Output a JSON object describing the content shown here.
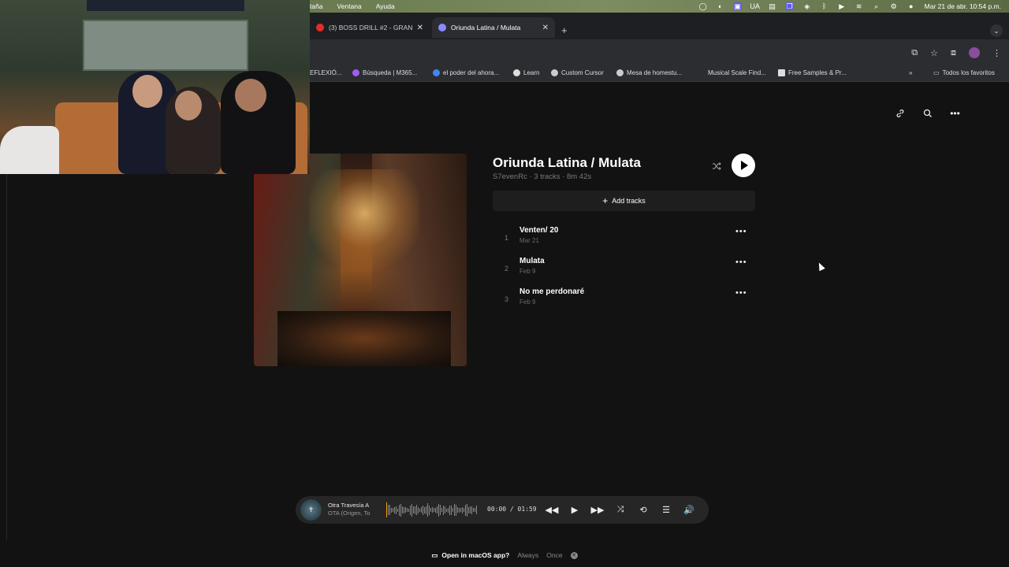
{
  "menubar": {
    "menus": [
      "taña",
      "Ventana",
      "Ayuda"
    ],
    "status_icons": [
      "record-icon",
      "activity-icon",
      "screen-icon",
      "ua-label",
      "keyboard-icon",
      "window-icon",
      "vpn-icon",
      "bluetooth-icon",
      "play-icon",
      "wifi-icon",
      "search-icon",
      "control-center-icon",
      "siri-icon"
    ],
    "ua_label": "UA",
    "datetime": "Mar 21 de abr.  10:54 p.m."
  },
  "tabs": [
    {
      "title": "(3) BOSS DRILL #2 - GRAND",
      "favicon_color": "#e52d27",
      "active": false
    },
    {
      "title": "Oriunda Latina / Mulata",
      "favicon_color": "#8a8aff",
      "active": true
    }
  ],
  "bookmarks": [
    {
      "label": "EFLEXIÓ...",
      "color": "#888"
    },
    {
      "label": "Búsqueda | M365...",
      "color": "#a35cf0"
    },
    {
      "label": "el poder del ahora...",
      "color": "#4285f4"
    },
    {
      "label": "Learn",
      "color": "#dddddd"
    },
    {
      "label": "Custom Cursor",
      "color": "#cccccc"
    },
    {
      "label": "Mesa de homestu...",
      "color": "#cccccc"
    },
    {
      "label": "Musical Scale Find...",
      "color": "#2b2d31"
    },
    {
      "label": "Free Samples & Pr...",
      "color": "#dddddd"
    },
    {
      "label": "»",
      "color": "#2b2d31"
    },
    {
      "label": "Todos los favoritos",
      "color": "#dddddd"
    }
  ],
  "playlist": {
    "title": "Oriunda Latina / Mulata",
    "meta": "S7evenRc · 3 tracks · 8m 42s",
    "add_tracks_label": "Add tracks",
    "tracks": [
      {
        "num": "1",
        "name": "Venten/ 20",
        "date": "Mar 21"
      },
      {
        "num": "2",
        "name": "Mulata",
        "date": "Feb 9"
      },
      {
        "num": "3",
        "name": "No me perdonaré",
        "date": "Feb 9"
      }
    ]
  },
  "player": {
    "track_title": "Otra Travesía A",
    "track_sub": "OTA (Origen, To",
    "time": "00:00 / 01:59",
    "progress": 0
  },
  "prompt": {
    "label": "Open in macOS app?",
    "always": "Always",
    "once": "Once"
  }
}
